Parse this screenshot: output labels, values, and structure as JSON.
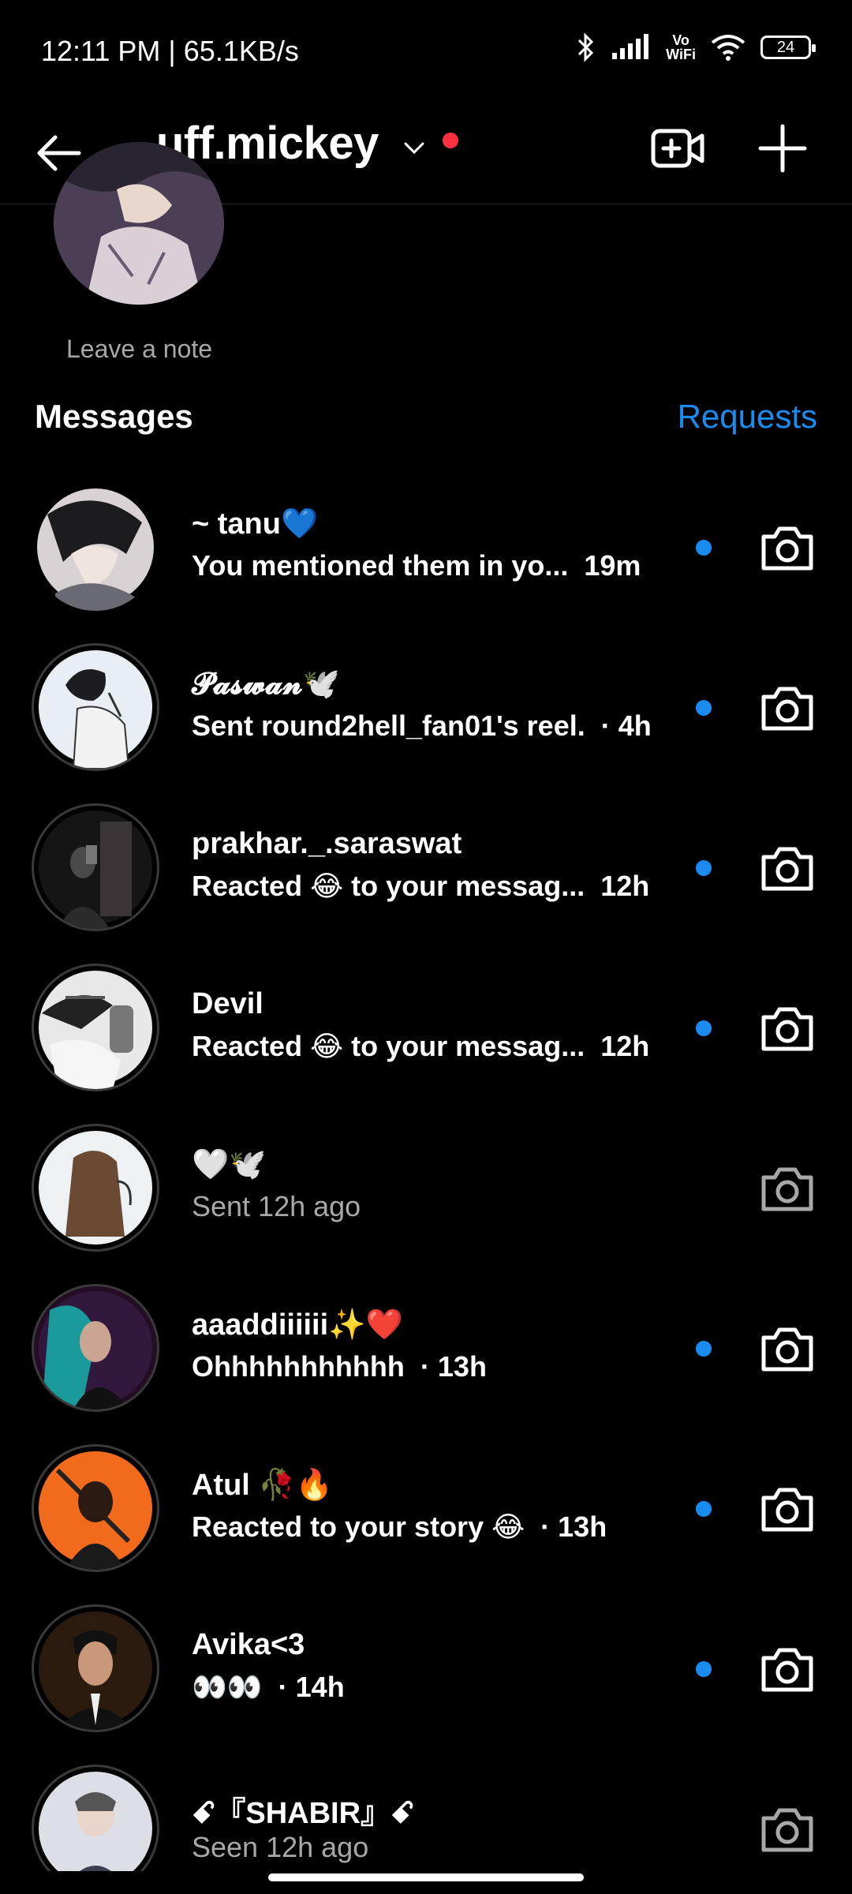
{
  "status_bar": {
    "time": "12:11 PM | 65.1KB/s",
    "vowifi_top": "Vo",
    "vowifi_bottom": "WiFi",
    "battery": "24"
  },
  "header": {
    "account": "uff.mickey"
  },
  "note": {
    "label": "Leave a note"
  },
  "messages": {
    "heading": "Messages",
    "requests": "Requests"
  },
  "conversations": [
    {
      "name": "~ tanu💙",
      "preview": "You mentioned them in yo...",
      "time": "19m",
      "unread": true
    },
    {
      "name": "𝓟𝓪𝓼𝔀𝓪𝓷🕊️",
      "preview": "Sent round2hell_fan01's reel.",
      "time": "· 4h",
      "unread": true
    },
    {
      "name": "prakhar._.saraswat",
      "preview": "Reacted 😂 to your messag...",
      "time": "12h",
      "unread": true
    },
    {
      "name": "Devil",
      "preview": "Reacted 😂 to your messag...",
      "time": "12h",
      "unread": true
    },
    {
      "name": "🤍🕊️",
      "preview": "Sent 12h ago",
      "time": "",
      "unread": false
    },
    {
      "name": "aaaddiiiiii✨❤️",
      "preview": "Ohhhhhhhhhhh",
      "time": "· 13h",
      "unread": true
    },
    {
      "name": "Atul 🥀🔥",
      "preview": "Reacted to your story 😂",
      "time": "· 13h",
      "unread": true
    },
    {
      "name": "Avika<3",
      "preview": "👀👀",
      "time": "· 14h",
      "unread": true
    },
    {
      "name": "ꗃ『SHABIR』ꗃ",
      "preview": "Seen 12h ago",
      "time": "",
      "unread": false
    }
  ],
  "colors": {
    "accent": "#1a8cf0",
    "live_dot": "#ff3040",
    "muted_text": "#a8a8a8"
  }
}
